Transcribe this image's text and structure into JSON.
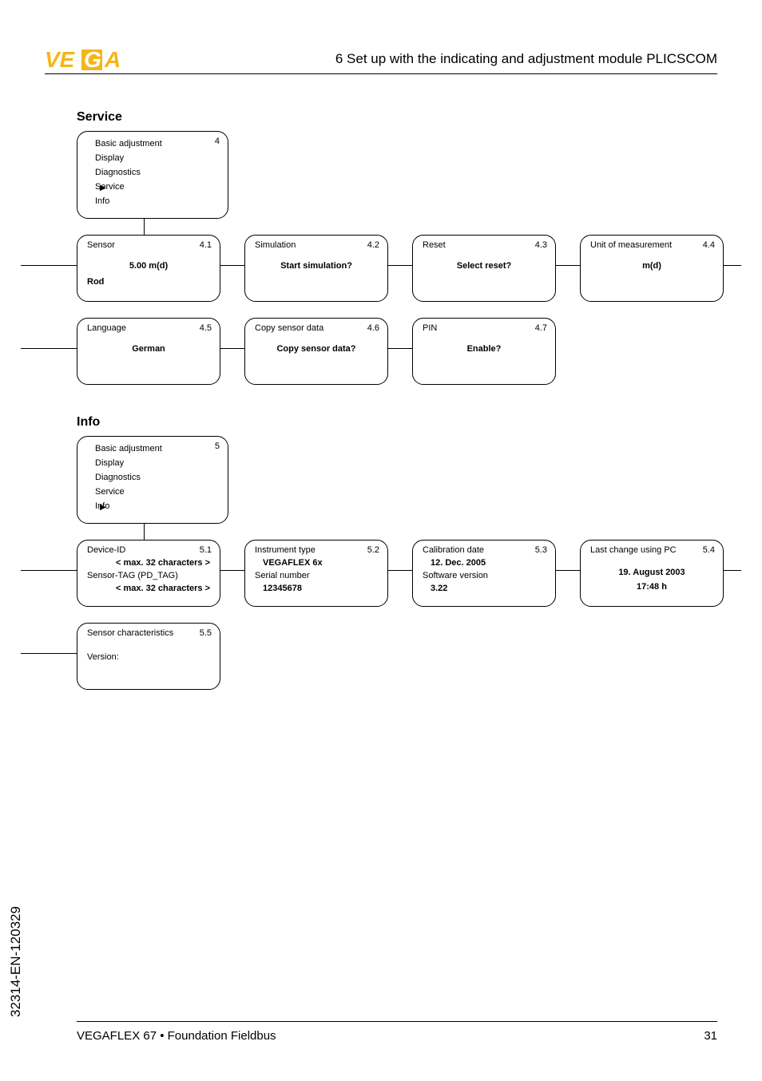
{
  "header": {
    "chapter": "6   Set up with the indicating and adjustment module PLICSCOM"
  },
  "service": {
    "heading": "Service",
    "menu": {
      "number": "4",
      "items": [
        "Basic adjustment",
        "Display",
        "Diagnostics",
        "Service",
        "Info"
      ],
      "active_index": 3
    },
    "screens": [
      {
        "num": "4.1",
        "title": "Sensor",
        "val1": "5.00 m(d)",
        "val2": "Rod"
      },
      {
        "num": "4.2",
        "title": "Simulation",
        "val1": "Start simulation?"
      },
      {
        "num": "4.3",
        "title": "Reset",
        "val1": "Select reset?"
      },
      {
        "num": "4.4",
        "title": "Unit of measurement",
        "val1": "m(d)"
      },
      {
        "num": "4.5",
        "title": "Language",
        "val1": "German"
      },
      {
        "num": "4.6",
        "title": "Copy sensor data",
        "val1": "Copy sensor data?"
      },
      {
        "num": "4.7",
        "title": "PIN",
        "val1": "Enable?"
      }
    ]
  },
  "info": {
    "heading": "Info",
    "menu": {
      "number": "5",
      "items": [
        "Basic adjustment",
        "Display",
        "Diagnostics",
        "Service",
        "Info"
      ],
      "active_index": 4
    },
    "screens": [
      {
        "num": "5.1",
        "title": "Device-ID",
        "val1": "< max. 32 characters >",
        "title2": "Sensor-TAG (PD_TAG)",
        "val2": "< max. 32 characters >"
      },
      {
        "num": "5.2",
        "title": "Instrument type",
        "val1": "VEGAFLEX 6x",
        "title2": "Serial number",
        "val2": "12345678"
      },
      {
        "num": "5.3",
        "title": "Calibration date",
        "val1": "12. Dec. 2005",
        "title2": "Software version",
        "val2": "3.22"
      },
      {
        "num": "5.4",
        "title": "Last change using PC",
        "val1": "19. August 2003",
        "val2": "17:48 h"
      },
      {
        "num": "5.5",
        "title": "Sensor characteristics",
        "title2": "Version:"
      }
    ]
  },
  "footer": {
    "side": "32314-EN-120329",
    "left": "VEGAFLEX 67 • Foundation Fieldbus",
    "right": "31"
  }
}
